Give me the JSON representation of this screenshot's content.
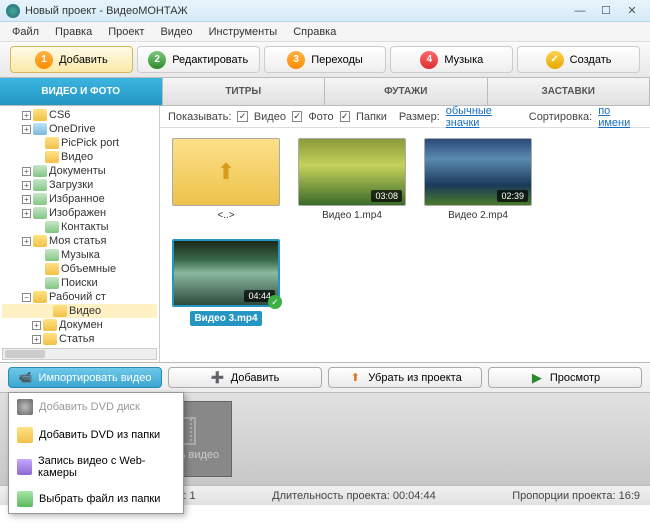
{
  "title": "Новый проект - ВидеоМОНТАЖ",
  "menu": [
    "Файл",
    "Правка",
    "Проект",
    "Видео",
    "Инструменты",
    "Справка"
  ],
  "steps": [
    {
      "num": "1",
      "label": "Добавить"
    },
    {
      "num": "2",
      "label": "Редактировать"
    },
    {
      "num": "3",
      "label": "Переходы"
    },
    {
      "num": "4",
      "label": "Музыка"
    },
    {
      "num": "",
      "label": "Создать"
    }
  ],
  "subtabs": [
    "ВИДЕО И ФОТО",
    "ТИТРЫ",
    "ФУТАЖИ",
    "ЗАСТАВКИ"
  ],
  "tree": [
    {
      "exp": "+",
      "icon": "folder",
      "label": "CS6",
      "indent": 18
    },
    {
      "exp": "+",
      "icon": "drive",
      "label": "OneDrive",
      "indent": 18
    },
    {
      "exp": "",
      "icon": "folder",
      "label": "PicPick port",
      "indent": 30
    },
    {
      "exp": "",
      "icon": "folder",
      "label": "Видео",
      "indent": 30
    },
    {
      "exp": "+",
      "icon": "spec",
      "label": "Документы",
      "indent": 18
    },
    {
      "exp": "+",
      "icon": "spec",
      "label": "Загрузки",
      "indent": 18
    },
    {
      "exp": "+",
      "icon": "spec",
      "label": "Избранное",
      "indent": 18
    },
    {
      "exp": "+",
      "icon": "spec",
      "label": "Изображен",
      "indent": 18
    },
    {
      "exp": "",
      "icon": "spec",
      "label": "Контакты",
      "indent": 30
    },
    {
      "exp": "+",
      "icon": "folder",
      "label": "Моя статья",
      "indent": 18
    },
    {
      "exp": "",
      "icon": "spec",
      "label": "Музыка",
      "indent": 30
    },
    {
      "exp": "",
      "icon": "folder",
      "label": "Объемные",
      "indent": 30
    },
    {
      "exp": "",
      "icon": "spec",
      "label": "Поиски",
      "indent": 30
    },
    {
      "exp": "−",
      "icon": "folder",
      "label": "Рабочий ст",
      "indent": 18
    },
    {
      "exp": "",
      "icon": "folder",
      "label": "Видео",
      "indent": 38,
      "sel": true
    },
    {
      "exp": "+",
      "icon": "folder",
      "label": "Докумен",
      "indent": 28
    },
    {
      "exp": "+",
      "icon": "folder",
      "label": "Статья",
      "indent": 28
    }
  ],
  "filter": {
    "show": "Показывать:",
    "video": "Видео",
    "photo": "Фото",
    "folders": "Папки",
    "size": "Размер:",
    "sizelink": "обычные значки",
    "sort": "Сортировка:",
    "sortlink": "по имени"
  },
  "thumbs": [
    {
      "type": "folder",
      "name": "<..>"
    },
    {
      "type": "vid1",
      "name": "Видео 1.mp4",
      "dur": "03:08"
    },
    {
      "type": "vid2",
      "name": "Видео 2.mp4",
      "dur": "02:39"
    },
    {
      "type": "vid3",
      "name": "Видео 3.mp4",
      "dur": "04:44",
      "sel": true,
      "ok": true
    }
  ],
  "actions": {
    "import": "Импортировать видео",
    "add": "Добавить",
    "remove": "Убрать из проекта",
    "preview": "Просмотр"
  },
  "popup": [
    {
      "label": "Добавить DVD диск",
      "icon": "pi1",
      "dis": true
    },
    {
      "label": "Добавить DVD из папки",
      "icon": "pi2"
    },
    {
      "label": "Запись видео с Web-камеры",
      "icon": "pi3"
    },
    {
      "label": "Выбрать файл из папки",
      "icon": "pi4"
    }
  ],
  "timeline_add": "Добавить видео",
  "status": {
    "files_label": "Количество добавленных файлов:",
    "files_count": "1",
    "duration_label": "Длительность проекта:",
    "duration_val": "00:04:44",
    "ratio_label": "Пропорции проекта:",
    "ratio_val": "16:9"
  }
}
